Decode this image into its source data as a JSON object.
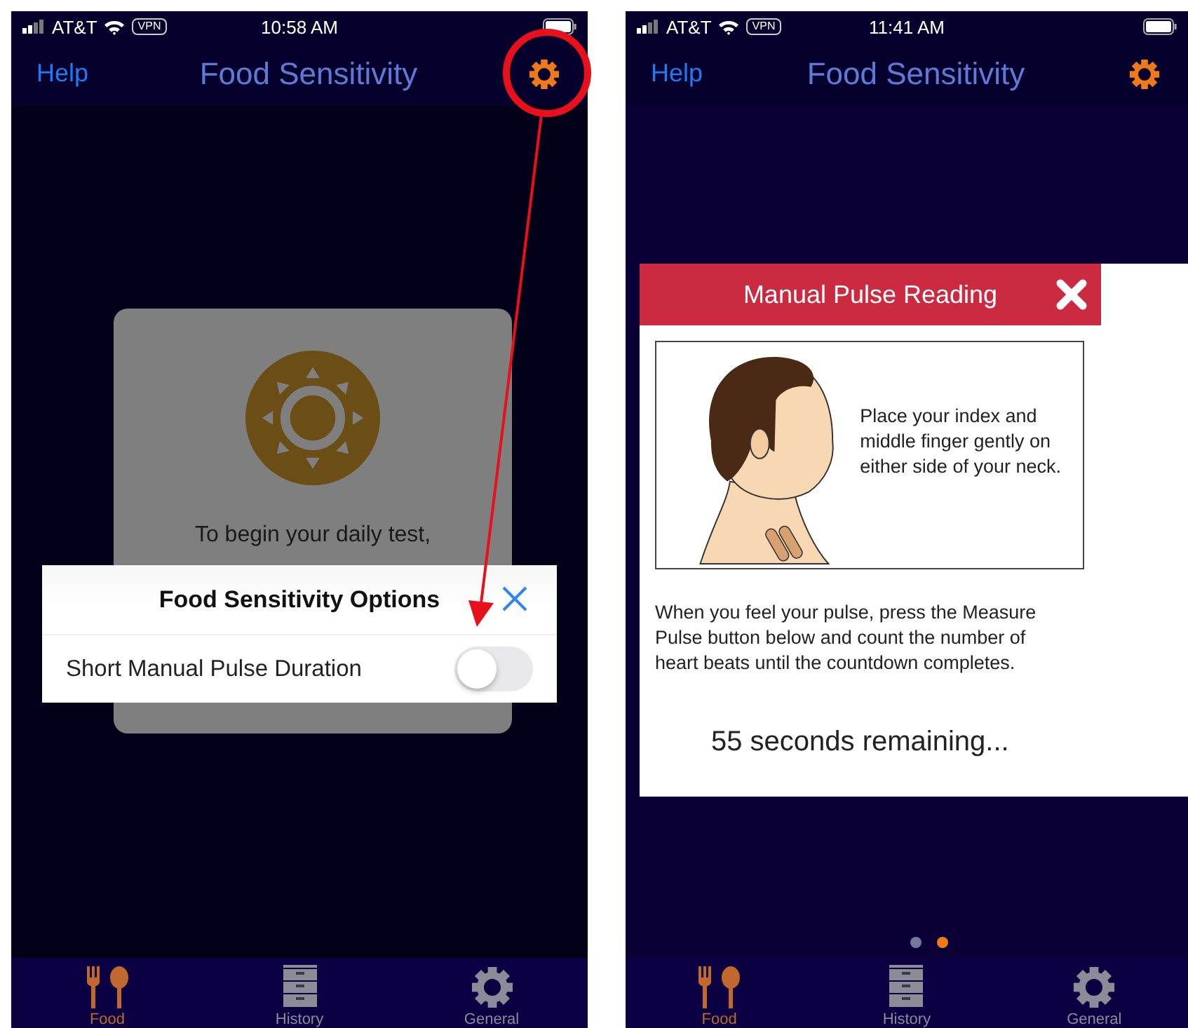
{
  "screens": [
    {
      "status_bar": {
        "carrier": "AT&T",
        "vpn": "VPN",
        "time": "10:58 AM"
      },
      "nav": {
        "left": "Help",
        "title": "Food Sensitivity"
      },
      "background_card": {
        "lines": [
          "To begin your daily test,"
        ]
      },
      "options_sheet": {
        "title": "Food Sensitivity Options",
        "rows": [
          {
            "label": "Short Manual Pulse Duration",
            "on": false
          }
        ]
      },
      "tabs": [
        {
          "label": "Food",
          "selected": true
        },
        {
          "label": "History",
          "selected": false
        },
        {
          "label": "General",
          "selected": false
        }
      ]
    },
    {
      "status_bar": {
        "carrier": "AT&T",
        "vpn": "VPN",
        "time": "11:41 AM"
      },
      "nav": {
        "left": "Help",
        "title": "Food Sensitivity"
      },
      "popup": {
        "title": "Manual Pulse Reading",
        "illustration_text": "Place your index and middle finger gently on either side of your neck.",
        "instructions": "When you feel your pulse, press the Measure Pulse button below and count the number of heart beats until the countdown completes.",
        "countdown": "55 seconds remaining..."
      },
      "page_dots": [
        {
          "selected": false
        },
        {
          "selected": true
        }
      ],
      "tabs": [
        {
          "label": "Food",
          "selected": true
        },
        {
          "label": "History",
          "selected": false
        },
        {
          "label": "General",
          "selected": false
        }
      ]
    }
  ]
}
